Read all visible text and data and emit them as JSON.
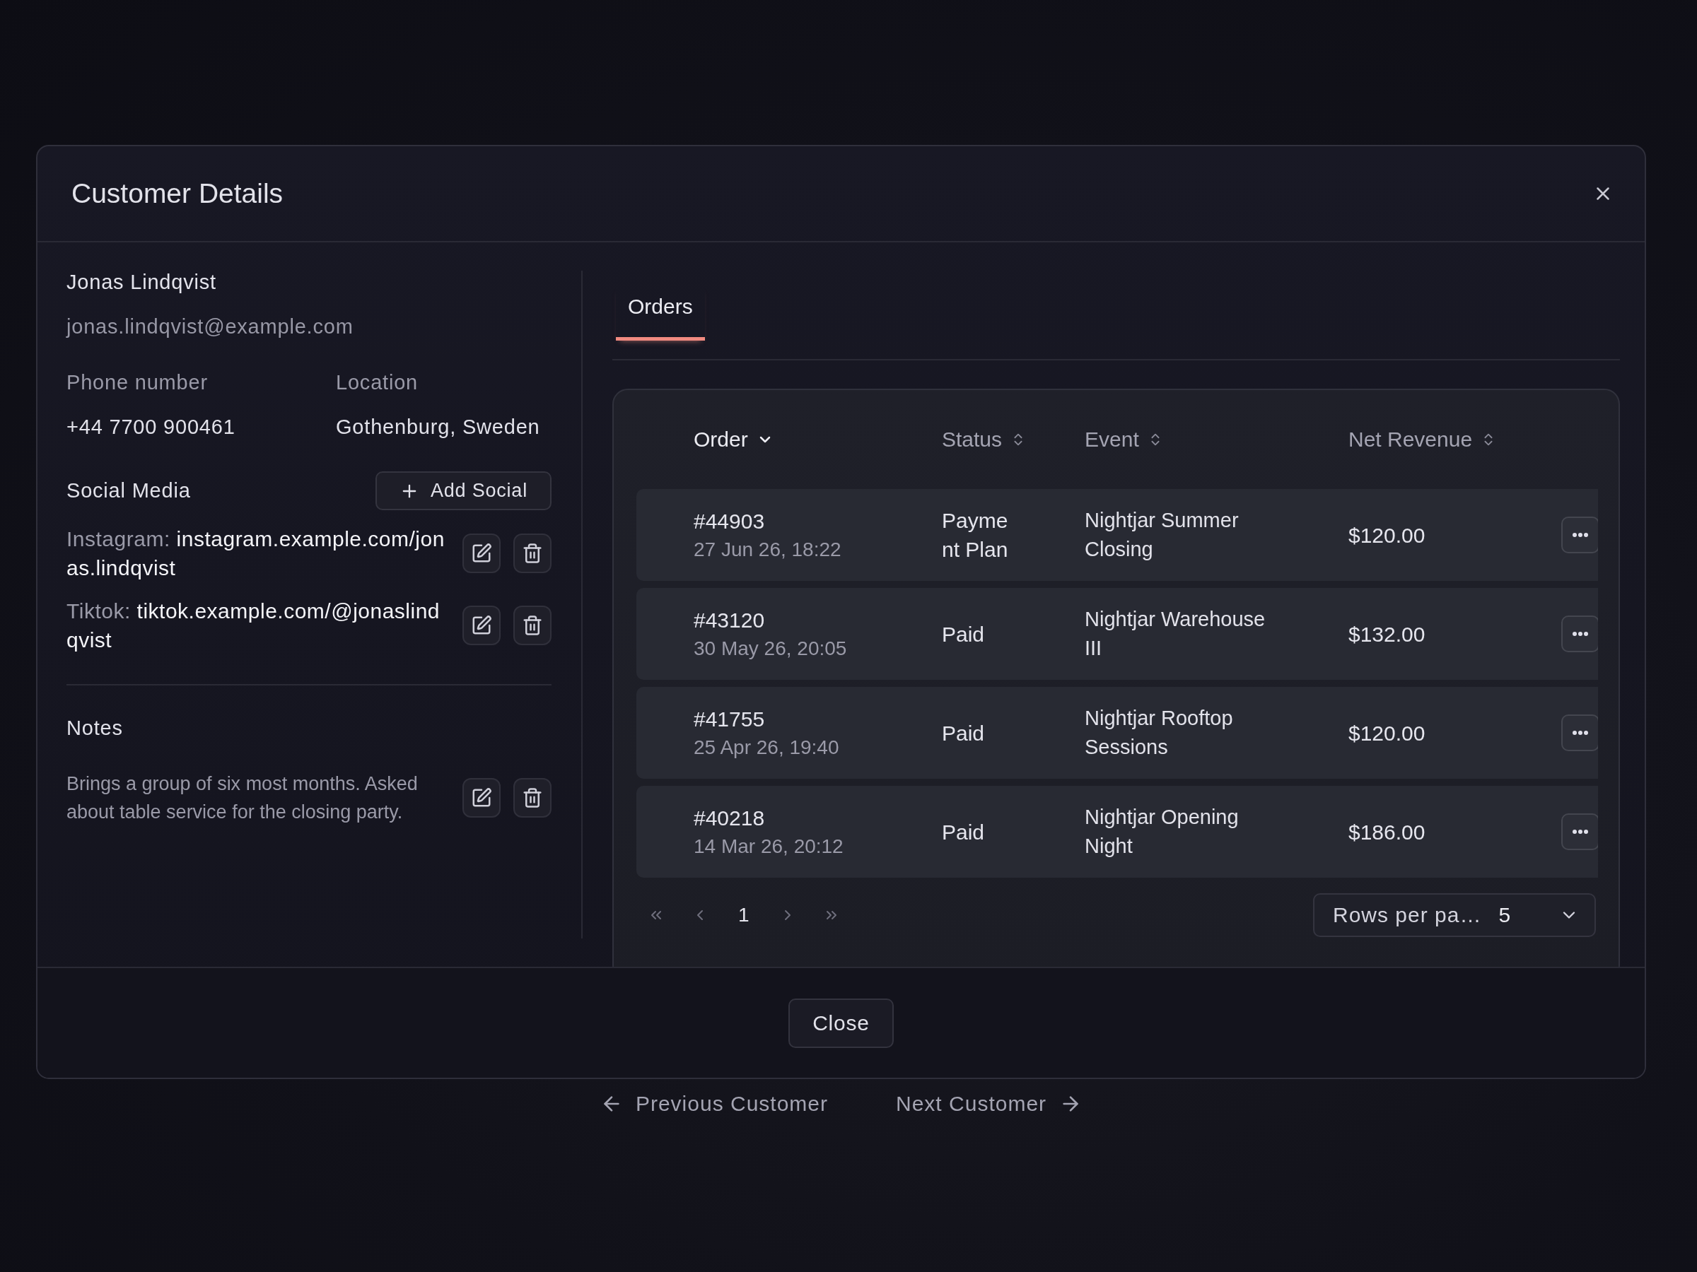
{
  "dialog": {
    "title": "Customer Details"
  },
  "customer": {
    "name": "Jonas Lindqvist",
    "email": "jonas.lindqvist@example.com",
    "fields": [
      {
        "label": "Phone number",
        "value": "+44 7700 900461"
      },
      {
        "label": "Location",
        "value": "Gothenburg, Sweden"
      }
    ]
  },
  "social": {
    "title": "Social Media",
    "add_button": "Add Social",
    "items": [
      {
        "platform": "Instagram:",
        "url": "instagram.example.com/jonas.lindqvist"
      },
      {
        "platform": "Tiktok:",
        "url": "tiktok.example.com/@jonaslindqvist"
      }
    ]
  },
  "notes": {
    "title": "Notes",
    "text": "Brings a group of six most months. Asked about table service for the closing party."
  },
  "tabs": [
    {
      "label": "Orders",
      "selected": true
    }
  ],
  "orders": {
    "columns": [
      {
        "label": "Order",
        "sorted": true
      },
      {
        "label": "Status",
        "sorted": false
      },
      {
        "label": "Event",
        "sorted": false
      },
      {
        "label": "Net Revenue",
        "sorted": false
      }
    ],
    "rows": [
      {
        "order": "#44903",
        "date": "27 Jun 26, 18:22",
        "status": "Payment Plan",
        "event": "Nightjar Summer Closing",
        "revenue": "$120.00"
      },
      {
        "order": "#43120",
        "date": "30 May 26, 20:05",
        "status": "Paid",
        "event": "Nightjar Warehouse III",
        "revenue": "$132.00"
      },
      {
        "order": "#41755",
        "date": "25 Apr 26, 19:40",
        "status": "Paid",
        "event": "Nightjar Rooftop Sessions",
        "revenue": "$120.00"
      },
      {
        "order": "#40218",
        "date": "14 Mar 26, 20:12",
        "status": "Paid",
        "event": "Nightjar Opening Night",
        "revenue": "$186.00"
      }
    ],
    "pagination": {
      "page": "1",
      "rows_label": "Rows per pa…",
      "rows_value": "5"
    }
  },
  "footer": {
    "close": "Close"
  },
  "nav": {
    "previous": "Previous Customer",
    "next": "Next Customer"
  }
}
